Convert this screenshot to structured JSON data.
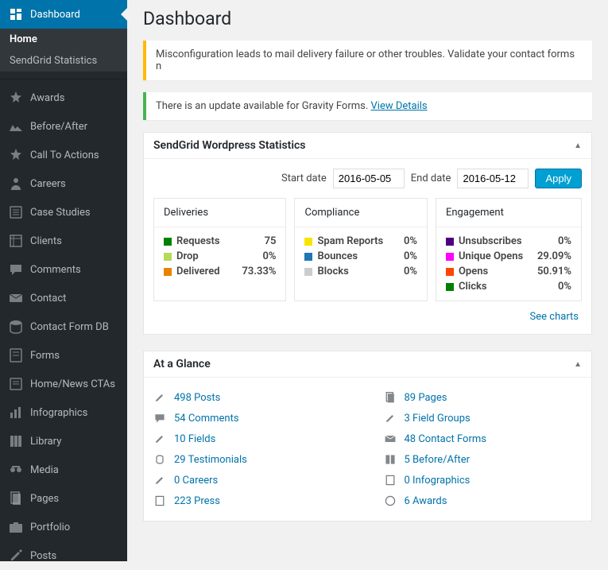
{
  "page_title": "Dashboard",
  "sidebar": {
    "current": "Dashboard",
    "submenu": [
      {
        "label": "Home",
        "active": true
      },
      {
        "label": "SendGrid Statistics",
        "active": false
      }
    ],
    "items": [
      "Awards",
      "Before/After",
      "Call To Actions",
      "Careers",
      "Case Studies",
      "Clients",
      "Comments",
      "Contact",
      "Contact Form DB",
      "Forms",
      "Home/News CTAs",
      "Infographics",
      "Library",
      "Media",
      "Pages",
      "Portfolio",
      "Posts"
    ]
  },
  "notices": {
    "warning": "Misconfiguration leads to mail delivery failure or other troubles. Validate your contact forms n",
    "update_text": "There is an update available for Gravity Forms. ",
    "update_link": "View Details"
  },
  "sendgrid": {
    "title": "SendGrid Wordpress Statistics",
    "start_label": "Start date",
    "start_value": "2016-05-05",
    "end_label": "End date",
    "end_value": "2016-05-12",
    "apply": "Apply",
    "see_charts": "See charts",
    "deliveries": {
      "title": "Deliveries",
      "rows": [
        {
          "color": "#008000",
          "label": "Requests",
          "value": "75"
        },
        {
          "color": "#b6d957",
          "label": "Drop",
          "value": "0%"
        },
        {
          "color": "#e98300",
          "label": "Delivered",
          "value": "73.33%"
        }
      ]
    },
    "compliance": {
      "title": "Compliance",
      "rows": [
        {
          "color": "#f9e300",
          "label": "Spam Reports",
          "value": "0%"
        },
        {
          "color": "#1f77b4",
          "label": "Bounces",
          "value": "0%"
        },
        {
          "color": "#cccccc",
          "label": "Blocks",
          "value": "0%"
        }
      ]
    },
    "engagement": {
      "title": "Engagement",
      "rows": [
        {
          "color": "#4b0082",
          "label": "Unsubscribes",
          "value": "0%"
        },
        {
          "color": "#ff00ff",
          "label": "Unique Opens",
          "value": "29.09%"
        },
        {
          "color": "#ff4500",
          "label": "Opens",
          "value": "50.91%"
        },
        {
          "color": "#008000",
          "label": "Clicks",
          "value": "0%"
        }
      ]
    }
  },
  "glance": {
    "title": "At a Glance",
    "left": [
      {
        "text": "498 Posts"
      },
      {
        "text": "54 Comments"
      },
      {
        "text": "10 Fields"
      },
      {
        "text": "29 Testimonials"
      },
      {
        "text": "0 Careers"
      },
      {
        "text": "223 Press"
      }
    ],
    "right": [
      {
        "text": "89 Pages"
      },
      {
        "text": "3 Field Groups"
      },
      {
        "text": "48 Contact Forms"
      },
      {
        "text": "5 Before/After"
      },
      {
        "text": "0 Infographics"
      },
      {
        "text": "6 Awards"
      }
    ]
  }
}
